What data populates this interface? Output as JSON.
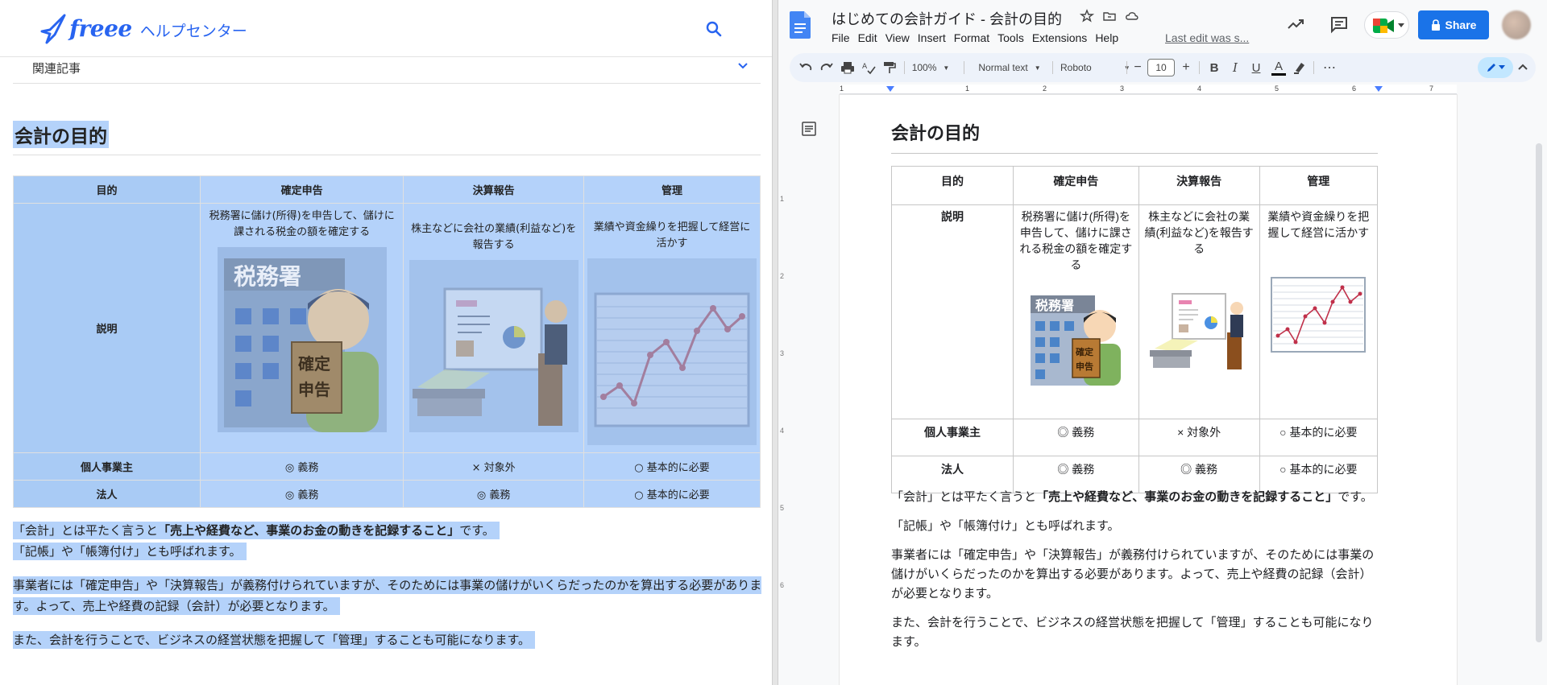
{
  "left": {
    "brand": "freee",
    "help_center": "ヘルプセンター",
    "related_label": "関連記事",
    "article_title": "会計の目的",
    "table": {
      "headers": [
        "目的",
        "確定申告",
        "決算報告",
        "管理"
      ],
      "desc_label": "説明",
      "descriptions": [
        "税務署に儲け(所得)を申告して、儲けに課される税金の額を確定する",
        "株主などに会社の業績(利益など)を報告する",
        "業績や資金繰りを把握して経営に活かす"
      ],
      "rows": [
        {
          "label": "個人事業主",
          "values": [
            "◎ 義務",
            "× 対象外",
            "○ 基本的に必要"
          ]
        },
        {
          "label": "法人",
          "values": [
            "◎ 義務",
            "◎ 義務",
            "○ 基本的に必要"
          ]
        }
      ]
    },
    "para1_pre": "「会計」とは平たく言うと",
    "para1_bold": "「売上や経費など、事業のお金の動きを記録すること」",
    "para1_post": "です。",
    "para1_line2": "「記帳」や「帳簿付け」とも呼ばれます。",
    "para2": "事業者には「確定申告」や「決算報告」が義務付けられていますが、そのためには事業の儲けがいくらだったのかを算出する必要があります。よって、売上や経費の記録（会計）が必要となります。",
    "para3": "また、会計を行うことで、ビジネスの経営状態を把握して「管理」することも可能になります。",
    "image_labels": {
      "tax_office": "税務署",
      "stamp_l1": "確定",
      "stamp_l2": "申告"
    }
  },
  "docs": {
    "title": "はじめての会計ガイド - 会計の目的",
    "menu": [
      "File",
      "Edit",
      "View",
      "Insert",
      "Format",
      "Tools",
      "Extensions",
      "Help"
    ],
    "last_edit": "Last edit was s...",
    "share_label": "Share",
    "toolbar": {
      "zoom": "100%",
      "style": "Normal text",
      "font": "Roboto",
      "font_size": "10",
      "bold": "B",
      "italic": "I",
      "underline": "U",
      "text_color": "A",
      "more": "⋯",
      "minus": "−",
      "plus": "+"
    },
    "ruler_numbers": [
      "1",
      "1",
      "2",
      "3",
      "4",
      "5",
      "6",
      "7"
    ],
    "vruler_numbers": [
      "1",
      "2",
      "3",
      "4",
      "5",
      "6"
    ],
    "heading": "会計の目的",
    "table": {
      "headers": [
        "目的",
        "確定申告",
        "決算報告",
        "管理"
      ],
      "desc_label": "説明",
      "descriptions": [
        "税務署に儲け(所得)を申告して、儲けに課される税金の額を確定する",
        "株主などに会社の業績(利益など)を報告する",
        "業績や資金繰りを把握して経営に活かす"
      ],
      "rows": [
        {
          "label": "個人事業主",
          "values": [
            "◎ 義務",
            "× 対象外",
            "○ 基本的に必要"
          ]
        },
        {
          "label": "法人",
          "values": [
            "◎ 義務",
            "◎ 義務",
            "○ 基本的に必要"
          ]
        }
      ]
    },
    "para1_pre": "「会計」とは平たく言うと",
    "para1_bold": "「売上や経費など、事業のお金の動きを記録すること」",
    "para1_post": "です。",
    "para2": "「記帳」や「帳簿付け」とも呼ばれます。",
    "para3": "事業者には「確定申告」や「決算報告」が義務付けられていますが、そのためには事業の儲けがいくらだったのかを算出する必要があります。よって、売上や経費の記録（会計）が必要となります。",
    "para4": "また、会計を行うことで、ビジネスの経営状態を把握して「管理」することも可能になります。",
    "image_labels": {
      "tax_office": "税務署",
      "stamp_l1": "確定",
      "stamp_l2": "申告"
    }
  },
  "colors": {
    "selection": "#b4d2fa",
    "freee_blue": "#2864f0",
    "share_blue": "#1a73e8",
    "chart_line": "#c0304a"
  }
}
